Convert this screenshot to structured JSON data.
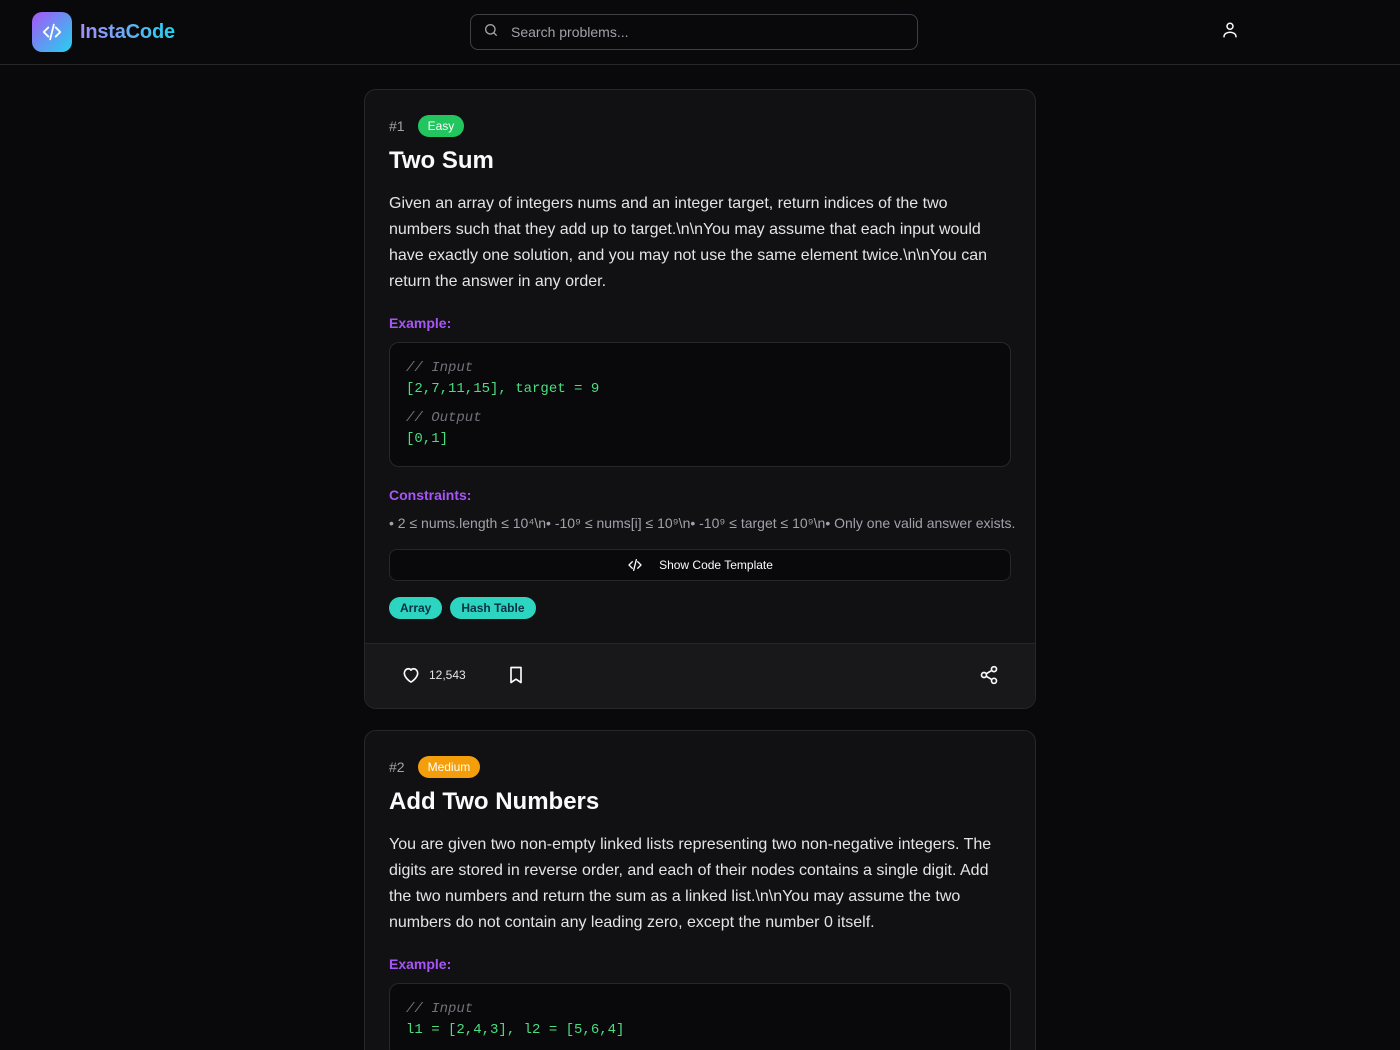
{
  "app": {
    "name": "InstaCode"
  },
  "search": {
    "placeholder": "Search problems..."
  },
  "problems": [
    {
      "number": "#1",
      "difficulty": "Easy",
      "title": "Two Sum",
      "description": "Given an array of integers nums and an integer target, return indices of the two numbers such that they add up to target.\\n\\nYou may assume that each input would have exactly one solution, and you may not use the same element twice.\\n\\nYou can return the answer in any order.",
      "example_label": "Example:",
      "example": {
        "input_comment": "// Input",
        "input": "[2,7,11,15], target = 9",
        "output_comment": "// Output",
        "output": "[0,1]"
      },
      "constraints_label": "Constraints:",
      "constraints": "• 2 ≤ nums.length ≤ 10⁴\\n• -10⁹ ≤ nums[i] ≤ 10⁹\\n• -10⁹ ≤ target ≤ 10⁹\\n• Only one valid answer exists.",
      "template_button": "Show Code Template",
      "tags": [
        "Array",
        "Hash Table"
      ],
      "likes": "12,543"
    },
    {
      "number": "#2",
      "difficulty": "Medium",
      "title": "Add Two Numbers",
      "description": "You are given two non-empty linked lists representing two non-negative integers. The digits are stored in reverse order, and each of their nodes contains a single digit. Add the two numbers and return the sum as a linked list.\\n\\nYou may assume the two numbers do not contain any leading zero, except the number 0 itself.",
      "example_label": "Example:",
      "example": {
        "input_comment": "// Input",
        "input": "l1 = [2,4,3], l2 = [5,6,4]"
      }
    }
  ],
  "colors": {
    "background": "#09090b",
    "card": "#111114",
    "accent": "#a855f7",
    "easy": "#22c55e",
    "medium": "#f59e0b",
    "tag": "#2dd4bf",
    "code_value": "#4ade80"
  }
}
